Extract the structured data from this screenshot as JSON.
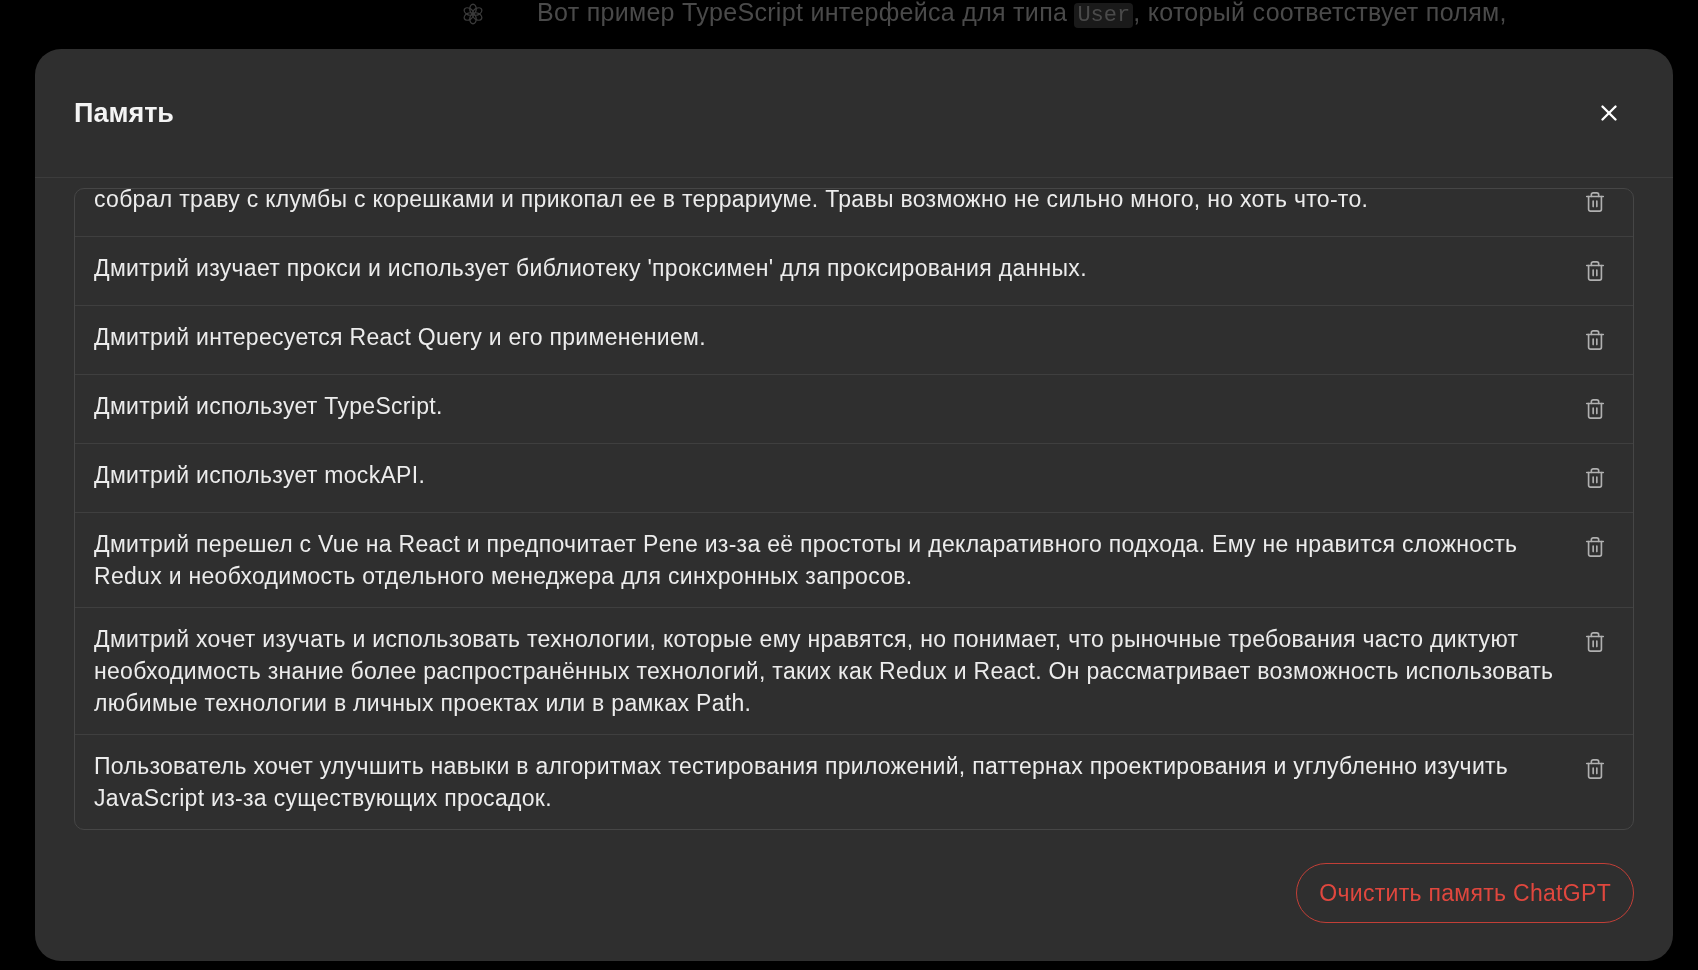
{
  "background_chat": {
    "message_parts": [
      {
        "kind": "text",
        "text": "Вот пример TypeScript интерфейса для типа "
      },
      {
        "kind": "code",
        "text": "User"
      },
      {
        "kind": "text",
        "text": ", который соответствует полям,"
      }
    ]
  },
  "dialog": {
    "title": "Память",
    "memories": [
      {
        "text": "собрал траву с клумбы с корешками и прикопал ее в террариуме. Травы возможно не сильно много, но хоть что-то."
      },
      {
        "text": "Дмитрий изучает прокси и использует библиотеку 'проксимен' для проксирования данных."
      },
      {
        "text": "Дмитрий интересуется React Query и его применением."
      },
      {
        "text": "Дмитрий использует TypeScript."
      },
      {
        "text": "Дмитрий использует mockAPI."
      },
      {
        "text": "Дмитрий перешел с Vue на React и предпочитает Pene из-за её простоты и декларативного подхода. Ему не нравится сложность Redux и необходимость отдельного менеджера для синхронных запросов."
      },
      {
        "text": "Дмитрий хочет изучать и использовать технологии, которые ему нравятся, но понимает, что рыночные требования часто диктуют необходимость знание более распространённых технологий, таких как Redux и React. Он рассматривает возможность использовать любимые технологии в личных проектах или в рамках Path."
      },
      {
        "text": "Пользователь хочет улучшить навыки в алгоритмах тестирования приложений, паттернах проектирования и углубленно изучить JavaScript из-за существующих просадок."
      }
    ],
    "clear_button": "Очистить память ChatGPT"
  }
}
